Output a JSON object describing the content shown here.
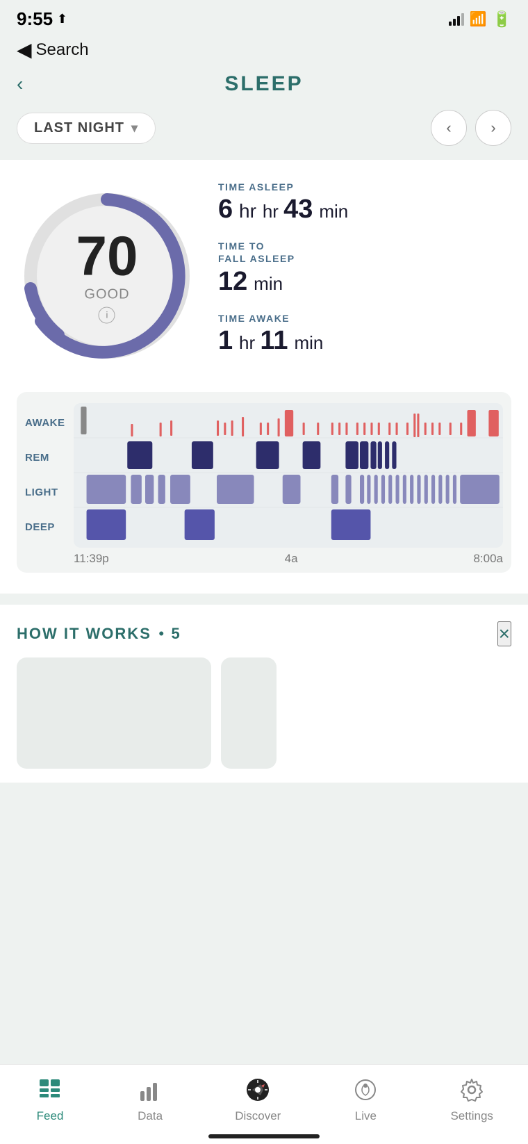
{
  "statusBar": {
    "time": "9:55",
    "locationIcon": "▶",
    "backLabel": "Search"
  },
  "header": {
    "title": "SLEEP",
    "backArrow": "‹"
  },
  "dateSelector": {
    "label": "LAST NIGHT",
    "chevron": "∨",
    "prevArrow": "‹",
    "nextArrow": "›"
  },
  "sleepScore": {
    "score": "70",
    "rating": "GOOD",
    "infoIcon": "i"
  },
  "stats": {
    "timeAsleep": {
      "label": "TIME ASLEEP",
      "hours": "6",
      "hourUnit": "hr",
      "minutes": "43",
      "minUnit": "min"
    },
    "timeToFall": {
      "label1": "TIME TO",
      "label2": "FALL ASLEEP",
      "minutes": "12",
      "minUnit": "min"
    },
    "timeAwake": {
      "label": "TIME AWAKE",
      "hours": "1",
      "hourUnit": "hr",
      "minutes": "11",
      "minUnit": "min"
    }
  },
  "chart": {
    "stages": [
      "AWAKE",
      "REM",
      "LIGHT",
      "DEEP"
    ],
    "timeLabels": [
      "11:39p",
      "4a",
      "8:00a"
    ]
  },
  "howItWorks": {
    "title": "HOW IT WORKS",
    "dot": "•",
    "count": "5",
    "closeIcon": "×"
  },
  "bottomNav": {
    "items": [
      {
        "id": "feed",
        "label": "Feed",
        "active": true
      },
      {
        "id": "data",
        "label": "Data",
        "active": false
      },
      {
        "id": "discover",
        "label": "Discover",
        "active": false
      },
      {
        "id": "live",
        "label": "Live",
        "active": false
      },
      {
        "id": "settings",
        "label": "Settings",
        "active": false
      }
    ]
  },
  "colors": {
    "accent": "#2c8a7a",
    "scoreRing": "#6b6baa",
    "remColor": "#2d2d6b",
    "lightColor": "#8888bb",
    "deepColor": "#5555aa",
    "awakeColor": "#e06060"
  }
}
